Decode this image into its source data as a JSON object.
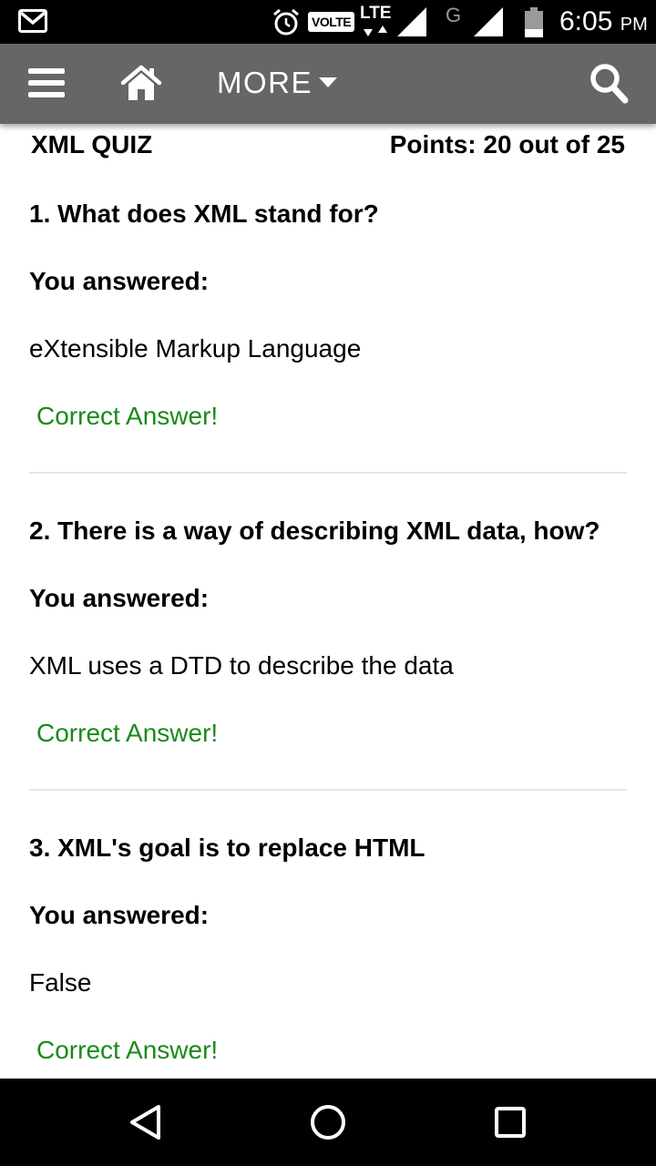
{
  "status_bar": {
    "icons": [
      "gmail-icon",
      "alarm-icon",
      "volte-badge",
      "lte-icon",
      "signal-icon",
      "signal-icon",
      "battery-icon"
    ],
    "volte_label": "VOLTE",
    "lte_label": "LTE",
    "network_g_label": "G",
    "time": "6:05",
    "ampm": "PM"
  },
  "toolbar": {
    "icons": [
      "hamburger-menu-icon",
      "home-icon",
      "caret-down-icon",
      "search-icon"
    ],
    "more_label": "MORE",
    "background_color": "#666666"
  },
  "quiz": {
    "title": "XML QUIZ",
    "points": "Points: 20 out of 25",
    "result_color": "#1a8a1a",
    "questions": [
      {
        "text": "1. What does XML stand for?",
        "answered_label": "You answered:",
        "answer": "eXtensible Markup Language",
        "result": "Correct Answer!"
      },
      {
        "text": "2. There is a way of describing XML data, how?",
        "answered_label": "You answered:",
        "answer": "XML uses a DTD to describe the data",
        "result": "Correct Answer!"
      },
      {
        "text": "3. XML's goal is to replace HTML",
        "answered_label": "You answered:",
        "answer": "False",
        "result": "Correct Answer!"
      }
    ]
  },
  "nav_bar": {
    "icons": [
      "back-icon",
      "home-circle-icon",
      "recents-square-icon"
    ]
  }
}
